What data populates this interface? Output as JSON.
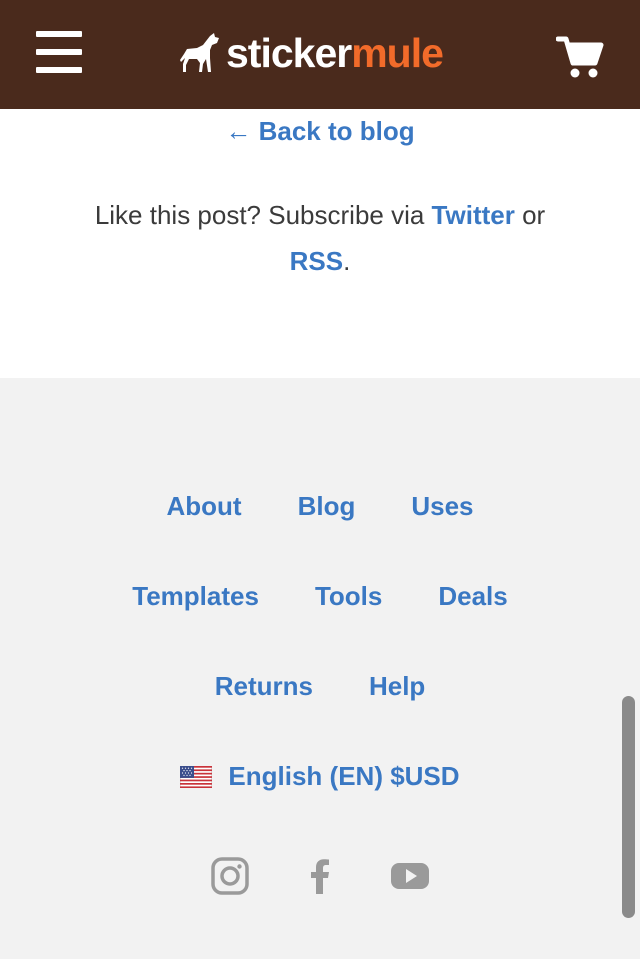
{
  "header": {
    "logo": {
      "part1": "sticker",
      "part2": "mule"
    },
    "menu_icon": "hamburger-menu-icon",
    "cart_icon": "shopping-cart-icon"
  },
  "content": {
    "back_link": "← Back to blog",
    "subscribe_prefix": "Like this post? Subscribe via ",
    "twitter_link": "Twitter",
    "subscribe_mid": " or ",
    "rss_link": "RSS",
    "subscribe_suffix": "."
  },
  "footer": {
    "row1": [
      "About",
      "Blog",
      "Uses"
    ],
    "row2": [
      "Templates",
      "Tools",
      "Deals"
    ],
    "row3": [
      "Returns",
      "Help"
    ],
    "locale": "English (EN) $USD",
    "social": [
      "instagram-icon",
      "facebook-icon",
      "youtube-icon"
    ]
  },
  "colors": {
    "header_bg": "#4a2a1c",
    "brand_orange": "#f26b2a",
    "link_blue": "#3a78c3",
    "footer_bg": "#f2f2f2",
    "icon_gray": "#9a9a9a"
  }
}
